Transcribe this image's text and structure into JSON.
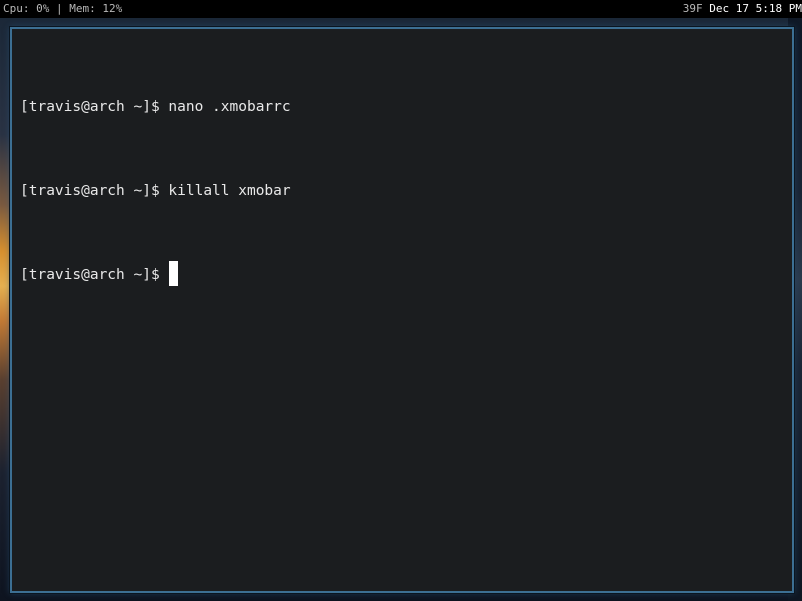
{
  "statusbar": {
    "cpu_text": "Cpu: 0%",
    "separator": "|",
    "mem_text": "Mem: 12%",
    "weather_text": "39F",
    "date_text": "Dec 17",
    "time_text": "5:18 PM"
  },
  "terminal": {
    "lines": [
      {
        "prompt": "[travis@arch ~]$ ",
        "command": "nano .xmobarrc"
      },
      {
        "prompt": "[travis@arch ~]$ ",
        "command": "killall xmobar"
      },
      {
        "prompt": "[travis@arch ~]$ ",
        "command": ""
      }
    ]
  },
  "colors": {
    "terminal_bg": "#1b1d1f",
    "window_border": "#3c6f93",
    "statusbar_bg": "#000000"
  }
}
